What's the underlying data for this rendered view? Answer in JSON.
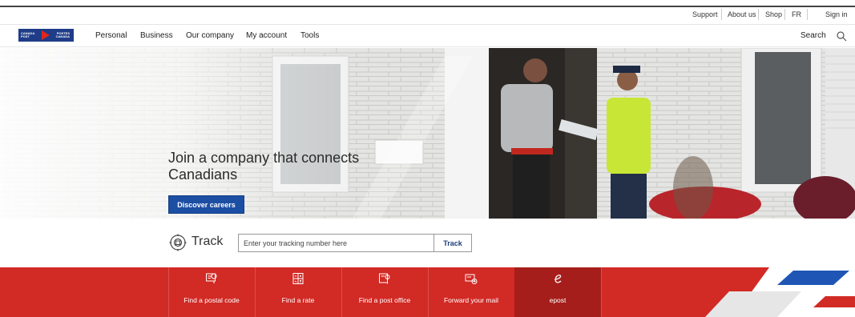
{
  "utility_nav": {
    "support": "Support",
    "about": "About us",
    "shop": "Shop",
    "lang": "FR",
    "signin": "Sign in"
  },
  "logo": {
    "left_text_1": "CANADA",
    "left_text_2": "POST",
    "right_text_1": "POSTES",
    "right_text_2": "CANADA"
  },
  "main_nav": {
    "items": [
      "Personal",
      "Business",
      "Our company",
      "My account",
      "Tools"
    ],
    "search_label": "Search"
  },
  "hero": {
    "title": "Join a company that connects Canadians",
    "cta_label": "Discover careers"
  },
  "track": {
    "label": "Track",
    "placeholder": "Enter your tracking number here",
    "button_label": "Track"
  },
  "quick_links": [
    {
      "label": "Find a postal code",
      "icon": "postal-code-icon"
    },
    {
      "label": "Find a rate",
      "icon": "rate-calculator-icon"
    },
    {
      "label": "Find a post office",
      "icon": "post-office-locator-icon"
    },
    {
      "label": "Forward your mail",
      "icon": "mail-forward-icon"
    },
    {
      "label": "epost",
      "icon": "epost-icon"
    }
  ],
  "colors": {
    "brand_red": "#d22a25",
    "brand_red_dark": "#a51e1b",
    "brand_blue": "#1c4ea4"
  }
}
